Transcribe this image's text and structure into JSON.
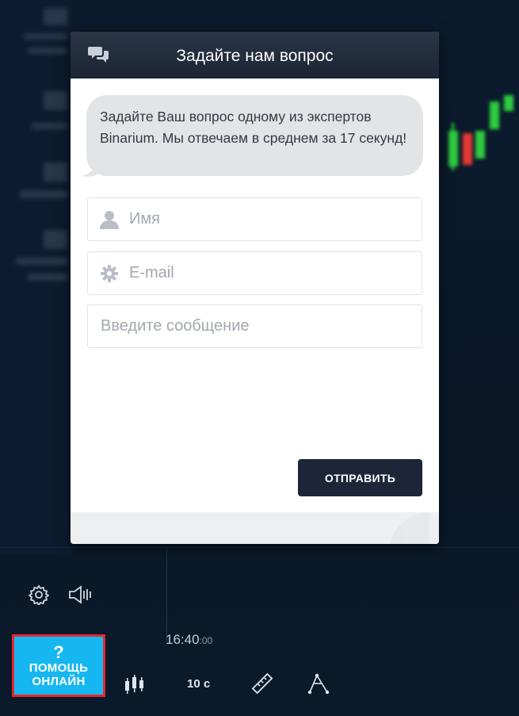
{
  "modal": {
    "title": "Задайте нам вопрос",
    "intro": "Задайте Ваш вопрос одному из экспертов Binarium. Мы отвечаем в среднем за 17 секунд!",
    "name_placeholder": "Имя",
    "email_placeholder": "E-mail",
    "message_placeholder": "Введите сообщение",
    "send_label": "ОТПРАВИТЬ"
  },
  "toolbar": {
    "time": "16:40",
    "time_seconds": ":00",
    "interval_label": "10 с",
    "help_icon": "?",
    "help_line1": "ПОМОЩЬ",
    "help_line2": "ОНЛАЙН"
  },
  "icons": {
    "chat": "chat-bubbles-icon",
    "name": "user-icon",
    "email": "gear-icon",
    "settings": "gear-icon",
    "sound": "speaker-icon",
    "candles": "candlestick-icon",
    "ruler": "ruler-icon",
    "draw": "draw-tool-icon"
  },
  "colors": {
    "help_button": "#16b7f0",
    "help_button_border": "#e8262d",
    "send_button": "#1c2638",
    "header": "#1b2535",
    "candle_up": "#2ecc40",
    "candle_down": "#e53935"
  }
}
